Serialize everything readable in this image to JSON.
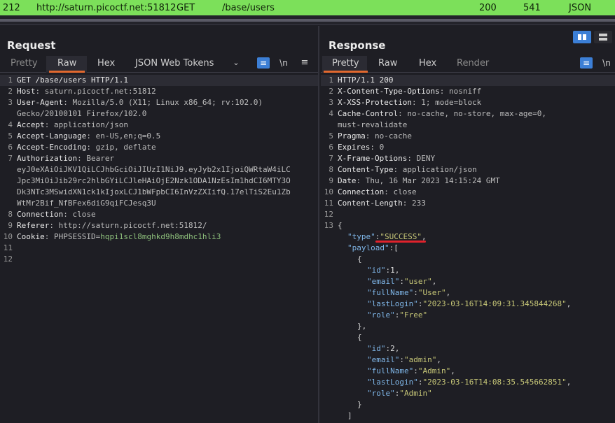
{
  "history": {
    "id": "212",
    "host": "http://saturn.picoctf.net:51812",
    "method": "GET",
    "url": "/base/users",
    "status": "200",
    "length": "541",
    "mime": "JSON"
  },
  "colors": {
    "accent": "#e2692f",
    "selected_row": "#7ce05a",
    "toggle_active": "#3c7fd6",
    "annotation": "#e0222c"
  },
  "request": {
    "title": "Request",
    "tabs": [
      "Pretty",
      "Raw",
      "Hex",
      "JSON Web Tokens"
    ],
    "active_tab": "Raw",
    "icons": [
      "chevron-down-icon",
      "wrap-icon",
      "newline-icon",
      "menu-icon"
    ],
    "newline_label": "\\n",
    "lines": [
      {
        "n": "1",
        "name": "GET /base/users HTTP/1.1",
        "value": ""
      },
      {
        "n": "2",
        "name": "Host",
        "value": ": saturn.picoctf.net:51812"
      },
      {
        "n": "3",
        "name": "User-Agent",
        "value": ": Mozilla/5.0 (X11; Linux x86_64; rv:102.0)"
      },
      {
        "n": "",
        "name": "",
        "value": "Gecko/20100101 Firefox/102.0"
      },
      {
        "n": "4",
        "name": "Accept",
        "value": ": application/json"
      },
      {
        "n": "5",
        "name": "Accept-Language",
        "value": ": en-US,en;q=0.5"
      },
      {
        "n": "6",
        "name": "Accept-Encoding",
        "value": ": gzip, deflate"
      },
      {
        "n": "7",
        "name": "Authorization",
        "value": ": Bearer"
      },
      {
        "n": "",
        "name": "",
        "value": "eyJ0eXAiOiJKV1QiLCJhbGciOiJIUzI1NiJ9.eyJyb2x1IjoiQWRtaW4iLC"
      },
      {
        "n": "",
        "name": "",
        "value": "Jpc3MiOiJib29rc2hlbGYiLCJleHAiOjE2Nzk1ODA1NzEsIm1hdCI6MTY3O"
      },
      {
        "n": "",
        "name": "",
        "value": "Dk3NTc3MSwidXN1ck1kIjoxLCJ1bWFpbCI6InVzZXIifQ.17elTiS2Eu1Zb"
      },
      {
        "n": "",
        "name": "",
        "value": "WtMr2Bif_NfBFex6diG9qiFCJesq3U"
      },
      {
        "n": "8",
        "name": "Connection",
        "value": ": close"
      },
      {
        "n": "9",
        "name": "Referer",
        "value": ": http://saturn.picoctf.net:51812/"
      },
      {
        "n": "10",
        "name": "Cookie",
        "value": ": PHPSESSID=",
        "cookie": "hqpi1scl8mghkd9h8mdhc1hli3"
      },
      {
        "n": "11",
        "name": "",
        "value": ""
      },
      {
        "n": "12",
        "name": "",
        "value": ""
      }
    ]
  },
  "response": {
    "title": "Response",
    "tabs": [
      "Pretty",
      "Raw",
      "Hex",
      "Render"
    ],
    "active_tab": "Pretty",
    "icons": [
      "wrap-icon",
      "newline-icon"
    ],
    "newline_label": "\\n",
    "layout_icons": [
      "split-horizontal-icon",
      "split-vertical-icon"
    ],
    "lines": [
      {
        "n": "1",
        "name": "HTTP/1.1 200",
        "value": ""
      },
      {
        "n": "2",
        "name": "X-Content-Type-Options",
        "value": ": nosniff"
      },
      {
        "n": "3",
        "name": "X-XSS-Protection",
        "value": ": 1; mode=block"
      },
      {
        "n": "4",
        "name": "Cache-Control",
        "value": ": no-cache, no-store, max-age=0,"
      },
      {
        "n": "",
        "name": "",
        "value": "must-revalidate"
      },
      {
        "n": "5",
        "name": "Pragma",
        "value": ": no-cache"
      },
      {
        "n": "6",
        "name": "Expires",
        "value": ": 0"
      },
      {
        "n": "7",
        "name": "X-Frame-Options",
        "value": ": DENY"
      },
      {
        "n": "8",
        "name": "Content-Type",
        "value": ": application/json"
      },
      {
        "n": "9",
        "name": "Date",
        "value": ": Thu, 16 Mar 2023 14:15:24 GMT"
      },
      {
        "n": "10",
        "name": "Connection",
        "value": ": close"
      },
      {
        "n": "11",
        "name": "Content-Length",
        "value": ": 233"
      },
      {
        "n": "12",
        "name": "",
        "value": ""
      }
    ],
    "json_start_line": "13",
    "json": {
      "type_key": "\"type\"",
      "type_value": "\"SUCCESS\"",
      "payload_key": "\"payload\"",
      "users": [
        {
          "id_key": "\"id\"",
          "id": "1",
          "email_key": "\"email\"",
          "email": "\"user\"",
          "fullName_key": "\"fullName\"",
          "fullName": "\"User\"",
          "lastLogin_key": "\"lastLogin\"",
          "lastLogin": "\"2023-03-16T14:09:31.345844268\"",
          "role_key": "\"role\"",
          "role": "\"Free\""
        },
        {
          "id_key": "\"id\"",
          "id": "2",
          "email_key": "\"email\"",
          "email": "\"admin\"",
          "fullName_key": "\"fullName\"",
          "fullName": "\"Admin\"",
          "lastLogin_key": "\"lastLogin\"",
          "lastLogin": "\"2023-03-16T14:08:35.545662851\"",
          "role_key": "\"role\"",
          "role": "\"Admin\""
        }
      ]
    }
  }
}
